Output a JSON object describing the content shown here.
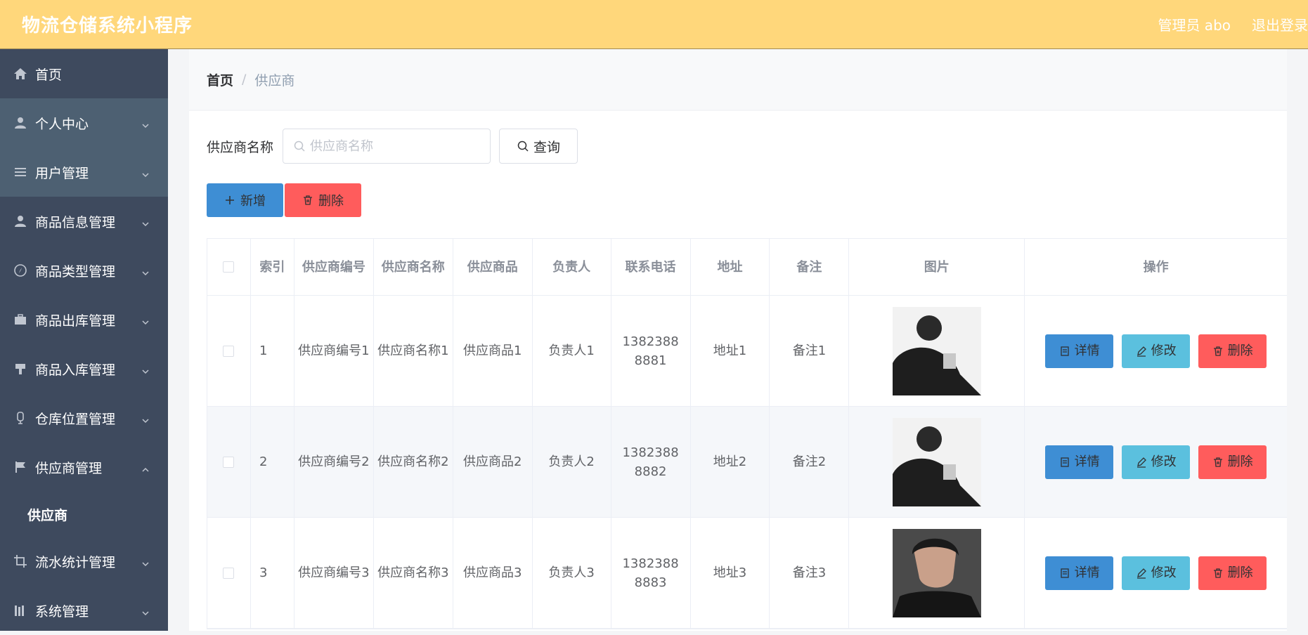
{
  "header": {
    "title": "物流仓储系统小程序",
    "user": "管理员 abo",
    "logout": "退出登录"
  },
  "sidebar": {
    "items": [
      {
        "label": "首页",
        "icon": "home-icon"
      },
      {
        "label": "个人中心",
        "icon": "user-icon"
      },
      {
        "label": "用户管理",
        "icon": "list-icon"
      },
      {
        "label": "商品信息管理",
        "icon": "user-icon"
      },
      {
        "label": "商品类型管理",
        "icon": "compass-icon"
      },
      {
        "label": "商品出库管理",
        "icon": "briefcase-icon"
      },
      {
        "label": "商品入库管理",
        "icon": "brush-icon"
      },
      {
        "label": "仓库位置管理",
        "icon": "microphone-icon"
      },
      {
        "label": "供应商管理",
        "icon": "flag-icon"
      },
      {
        "label": "流水统计管理",
        "icon": "crop-icon"
      },
      {
        "label": "系统管理",
        "icon": "books-icon"
      }
    ],
    "submenu": {
      "label": "供应商"
    }
  },
  "breadcrumb": {
    "home": "首页",
    "separator": "/",
    "current": "供应商"
  },
  "search": {
    "label": "供应商名称",
    "placeholder": "供应商名称",
    "button": "查询"
  },
  "actions": {
    "add": "新增",
    "delete": "删除"
  },
  "table": {
    "headers": [
      "索引",
      "供应商编号",
      "供应商名称",
      "供应商品",
      "负责人",
      "联系电话",
      "地址",
      "备注",
      "图片",
      "操作"
    ],
    "rows": [
      {
        "index": "1",
        "code": "供应商编号1",
        "name": "供应商名称1",
        "goods": "供应商品1",
        "owner": "负责人1",
        "phone": "13823888881",
        "address": "地址1",
        "remark": "备注1"
      },
      {
        "index": "2",
        "code": "供应商编号2",
        "name": "供应商名称2",
        "goods": "供应商品2",
        "owner": "负责人2",
        "phone": "13823888882",
        "address": "地址2",
        "remark": "备注2"
      },
      {
        "index": "3",
        "code": "供应商编号3",
        "name": "供应商名称3",
        "goods": "供应商品3",
        "owner": "负责人3",
        "phone": "13823888883",
        "address": "地址3",
        "remark": "备注3"
      }
    ],
    "op_labels": {
      "detail": "详情",
      "edit": "修改",
      "delete": "删除"
    }
  },
  "colors": {
    "header_bg": "#ffd77b",
    "sidebar_bg": "#3e4a5e",
    "primary": "#3e8ed4",
    "info": "#5bc0de",
    "danger": "#ff5c5c"
  }
}
